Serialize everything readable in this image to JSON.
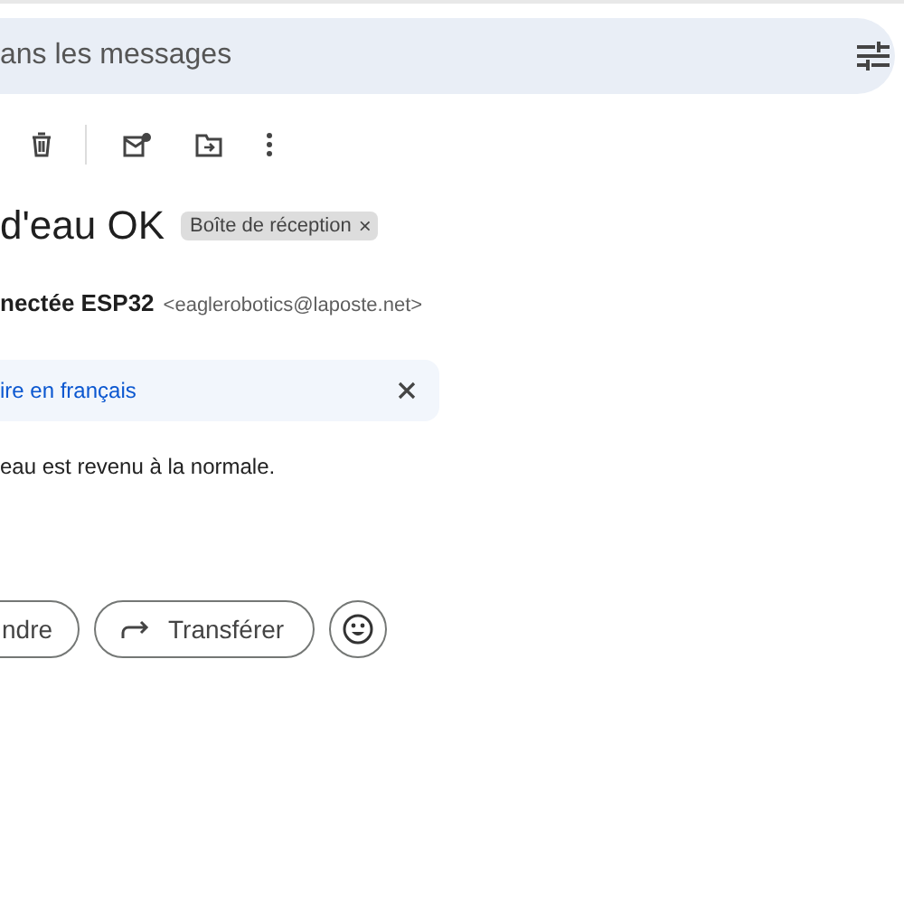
{
  "search": {
    "placeholder": "ans les messages"
  },
  "subject": "d'eau OK",
  "label_chip": {
    "text": "Boîte de réception",
    "remove": "×"
  },
  "sender": {
    "name": "nectée ESP32",
    "email": "<eaglerobotics@laposte.net>"
  },
  "translate_banner": {
    "link": "ire en français"
  },
  "body": "eau est revenu à la normale.",
  "actions": [
    {
      "kind": "text",
      "label": "ndre"
    },
    {
      "kind": "forward",
      "label": "Transférer"
    },
    {
      "kind": "emoji"
    }
  ]
}
